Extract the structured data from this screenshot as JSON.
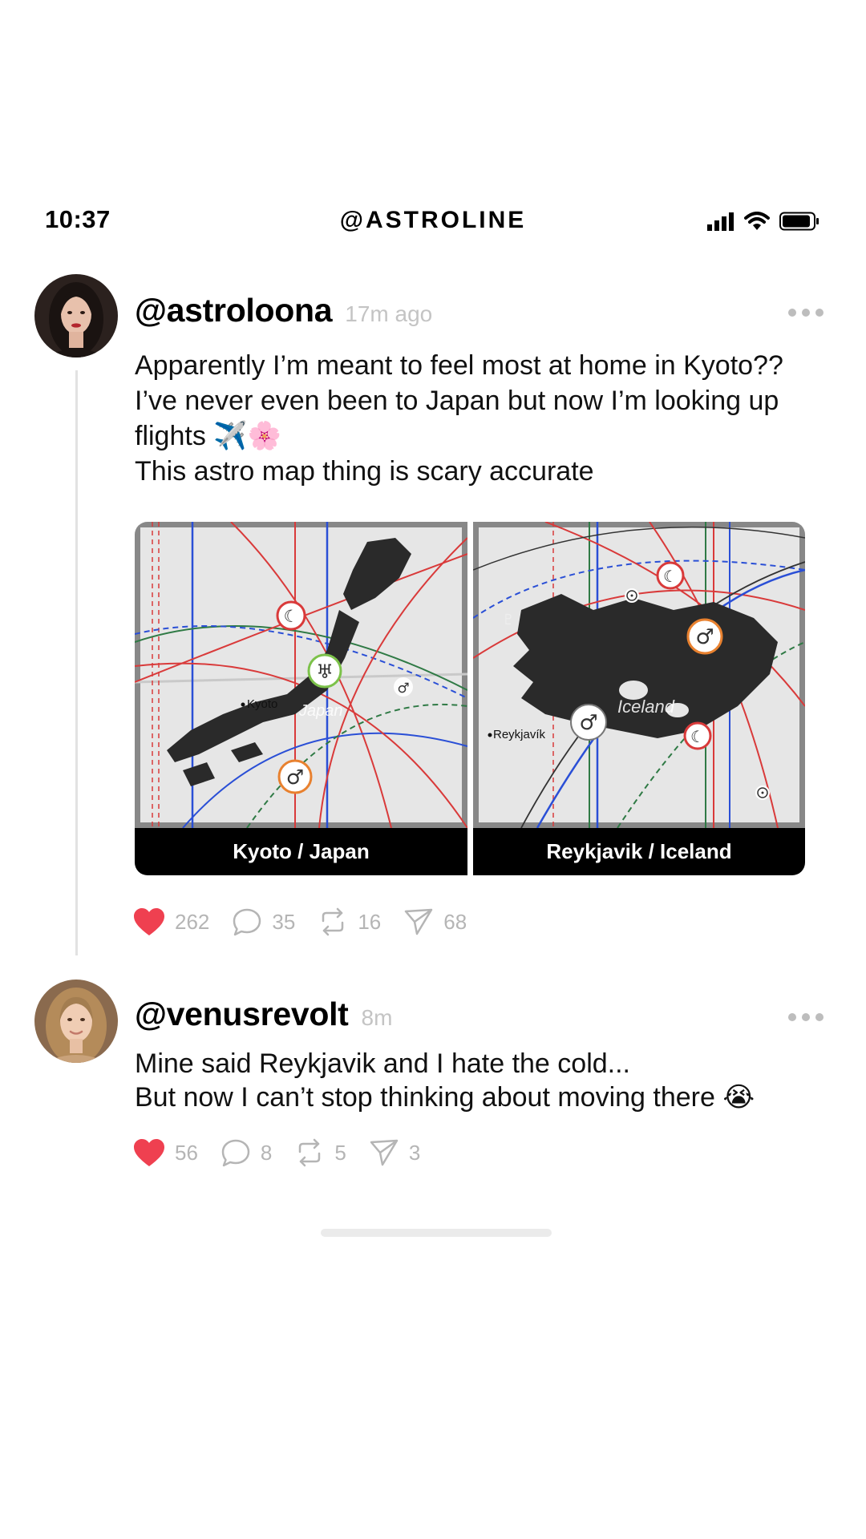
{
  "status_bar": {
    "time": "10:37",
    "app_title": "@ASTROLINE"
  },
  "posts": [
    {
      "username": "@astroloona",
      "time": "17m ago",
      "text_lines": [
        "Apparently I’m meant to feel most at home in Kyoto??",
        "I’ve never even been to Japan but now I’m looking up",
        "flights ✈️🌸",
        "This astro map thing is scary accurate"
      ],
      "maps": [
        {
          "caption": "Kyoto / Japan",
          "city_label": "Kyoto",
          "country_label": "Japan",
          "icons": [
            "moon-icon",
            "uranus-icon",
            "mars-icon",
            "mars-icon"
          ]
        },
        {
          "caption": "Reykjavik / Iceland",
          "city_label": "Reykjavík",
          "country_label": "Iceland",
          "icons": [
            "moon-icon",
            "mars-icon",
            "mars-icon",
            "moon-icon",
            "sun-icon",
            "pluto-icon"
          ]
        }
      ],
      "stats": {
        "likes": "262",
        "comments": "35",
        "reposts": "16",
        "shares": "68"
      }
    },
    {
      "username": "@venusrevolt",
      "time": "8m",
      "text_lines": [
        "Mine said Reykjavik and I hate the cold...",
        "But now I can’t stop thinking about moving there 😭"
      ],
      "stats": {
        "likes": "56",
        "comments": "8",
        "reposts": "5",
        "shares": "3"
      }
    }
  ],
  "colors": {
    "like": "#ef4050",
    "muted": "#b5b5b5",
    "line_red": "#d93a3a",
    "line_blue": "#2a4fd6",
    "line_green": "#2f7a45",
    "line_dark": "#333333",
    "mars_orange": "#e8812f",
    "uranus_green": "#7cc24a"
  }
}
